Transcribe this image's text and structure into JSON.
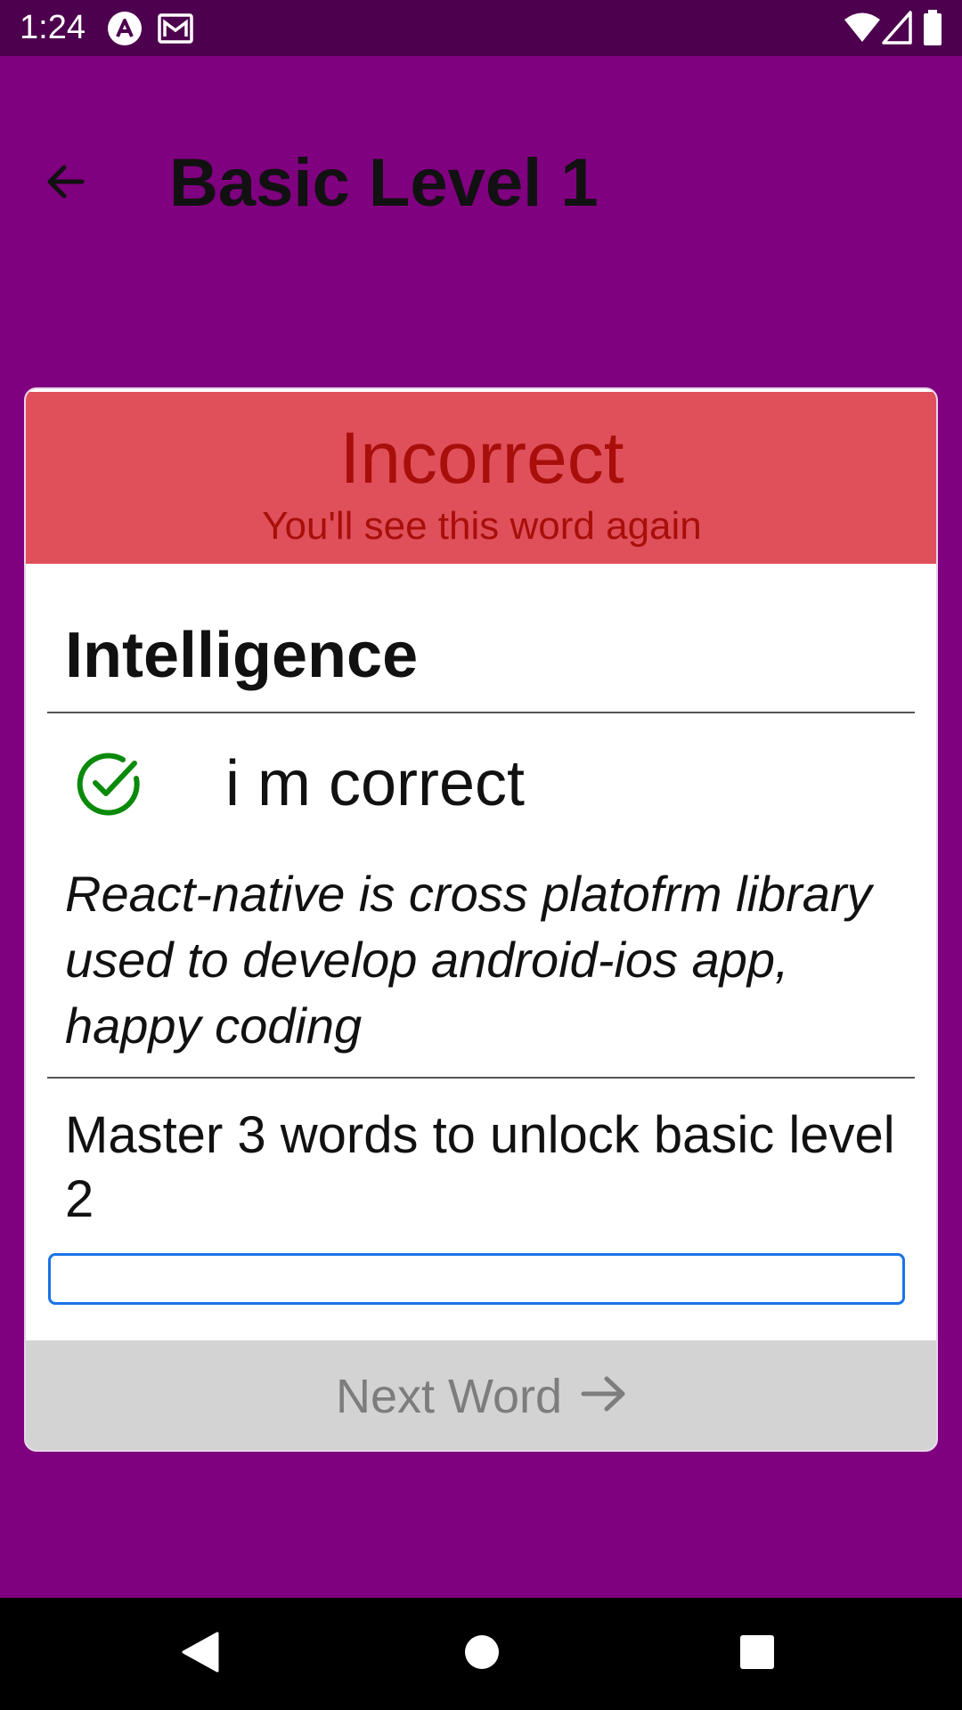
{
  "status_bar": {
    "time": "1:24",
    "icons": [
      "app-notification-icon",
      "gmail-icon",
      "wifi-icon",
      "signal-icon",
      "battery-icon"
    ]
  },
  "app_bar": {
    "title": "Basic Level 1",
    "back_icon": "arrow-back-icon"
  },
  "feedback": {
    "title": "Incorrect",
    "subtitle": "You'll see this word again",
    "color": "#e0505b",
    "text_color": "#a80f0a"
  },
  "word": {
    "title": "Intelligence",
    "answer": "i m correct",
    "answer_icon": "check-circle-icon",
    "definition": "React-native is cross platofrm library used to develop android-ios app, happy coding"
  },
  "progress": {
    "text": "Master 3 words to unlock basic level 2",
    "fraction": 0
  },
  "next_button": {
    "label": "Next Word",
    "icon": "arrow-right-icon"
  },
  "nav_bar": {
    "icons": [
      "back-nav-icon",
      "home-nav-icon",
      "recents-nav-icon"
    ]
  },
  "colors": {
    "background": "#7f017f",
    "status_bar": "#4d004d",
    "check": "#0a8a0a",
    "progress_border": "#1a73e8"
  }
}
